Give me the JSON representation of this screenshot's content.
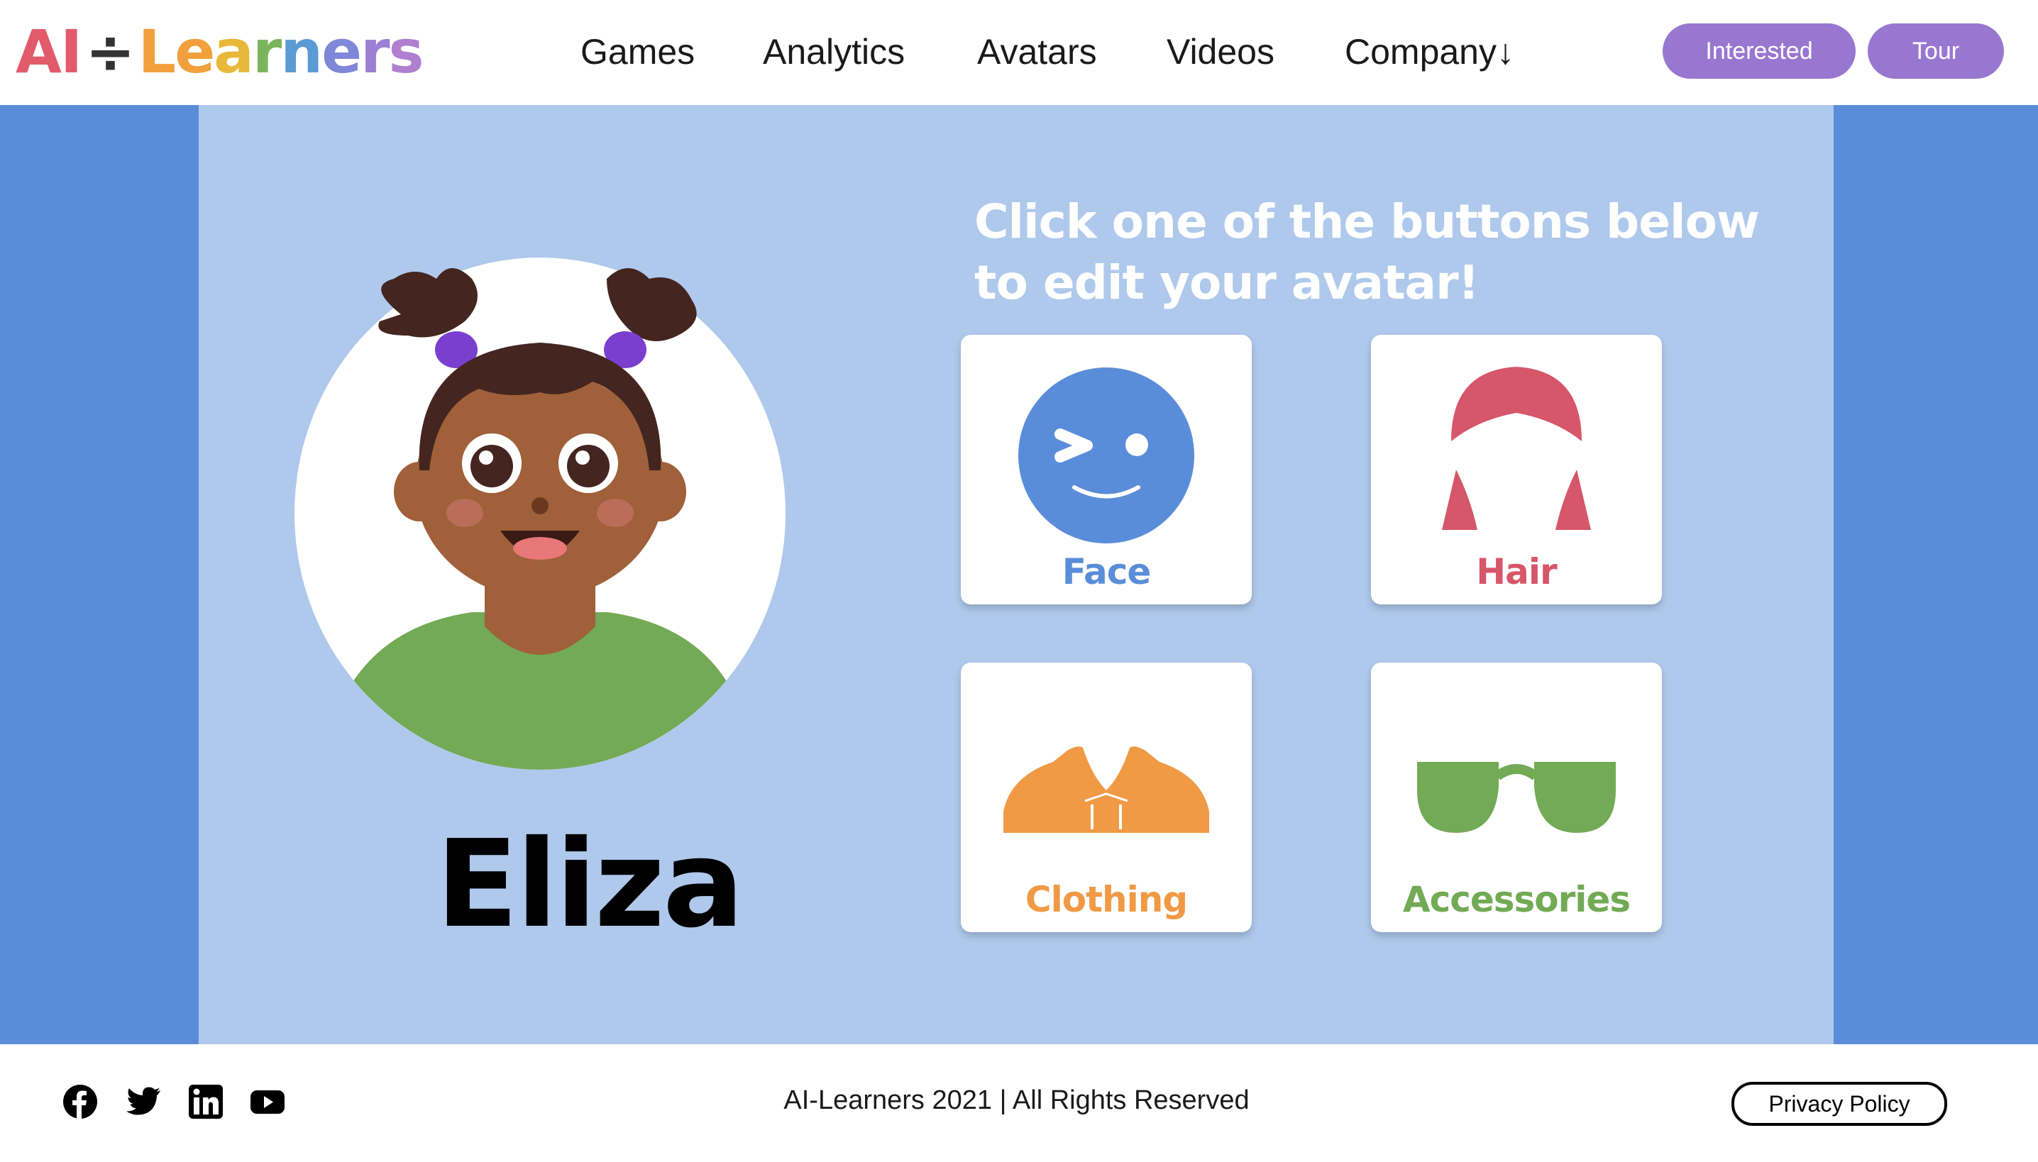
{
  "header": {
    "logo": {
      "parts": [
        {
          "text": "AI",
          "color": "#e25b6b"
        },
        {
          "text": "÷",
          "color": "#333333"
        },
        {
          "text": "L",
          "color": "#f2a03d"
        },
        {
          "text": "e",
          "color": "#f2a03d"
        },
        {
          "text": "a",
          "color": "#e8b83a"
        },
        {
          "text": "r",
          "color": "#7ab55c"
        },
        {
          "text": "n",
          "color": "#5b9bd5"
        },
        {
          "text": "e",
          "color": "#7f87d8"
        },
        {
          "text": "r",
          "color": "#9b7fd4"
        },
        {
          "text": "s",
          "color": "#b07fd0"
        }
      ]
    },
    "nav": {
      "games": "Games",
      "analytics": "Analytics",
      "avatars": "Avatars",
      "videos": "Videos",
      "company": "Company↓"
    },
    "buttons": {
      "interested": "Interested",
      "tour": "Tour"
    }
  },
  "main": {
    "avatar_name": "Eliza",
    "instructions": {
      "line1": "Click one of the buttons below",
      "line2": "to edit your avatar!"
    },
    "cards": {
      "face": {
        "label": "Face",
        "color": "#5a8dd9"
      },
      "hair": {
        "label": "Hair",
        "color": "#d6566a"
      },
      "clothing": {
        "label": "Clothing",
        "color": "#f09a45"
      },
      "accessories": {
        "label": "Accessories",
        "color": "#72aa55"
      }
    }
  },
  "footer": {
    "social_icons": [
      "facebook-icon",
      "twitter-icon",
      "linkedin-icon",
      "youtube-icon"
    ],
    "copyright": "AI-Learners 2021 | All Rights Reserved",
    "privacy": "Privacy Policy"
  },
  "colors": {
    "side_blue": "#5a8dd9",
    "panel_blue": "#afc9ec",
    "pill_purple": "#9877d0"
  }
}
